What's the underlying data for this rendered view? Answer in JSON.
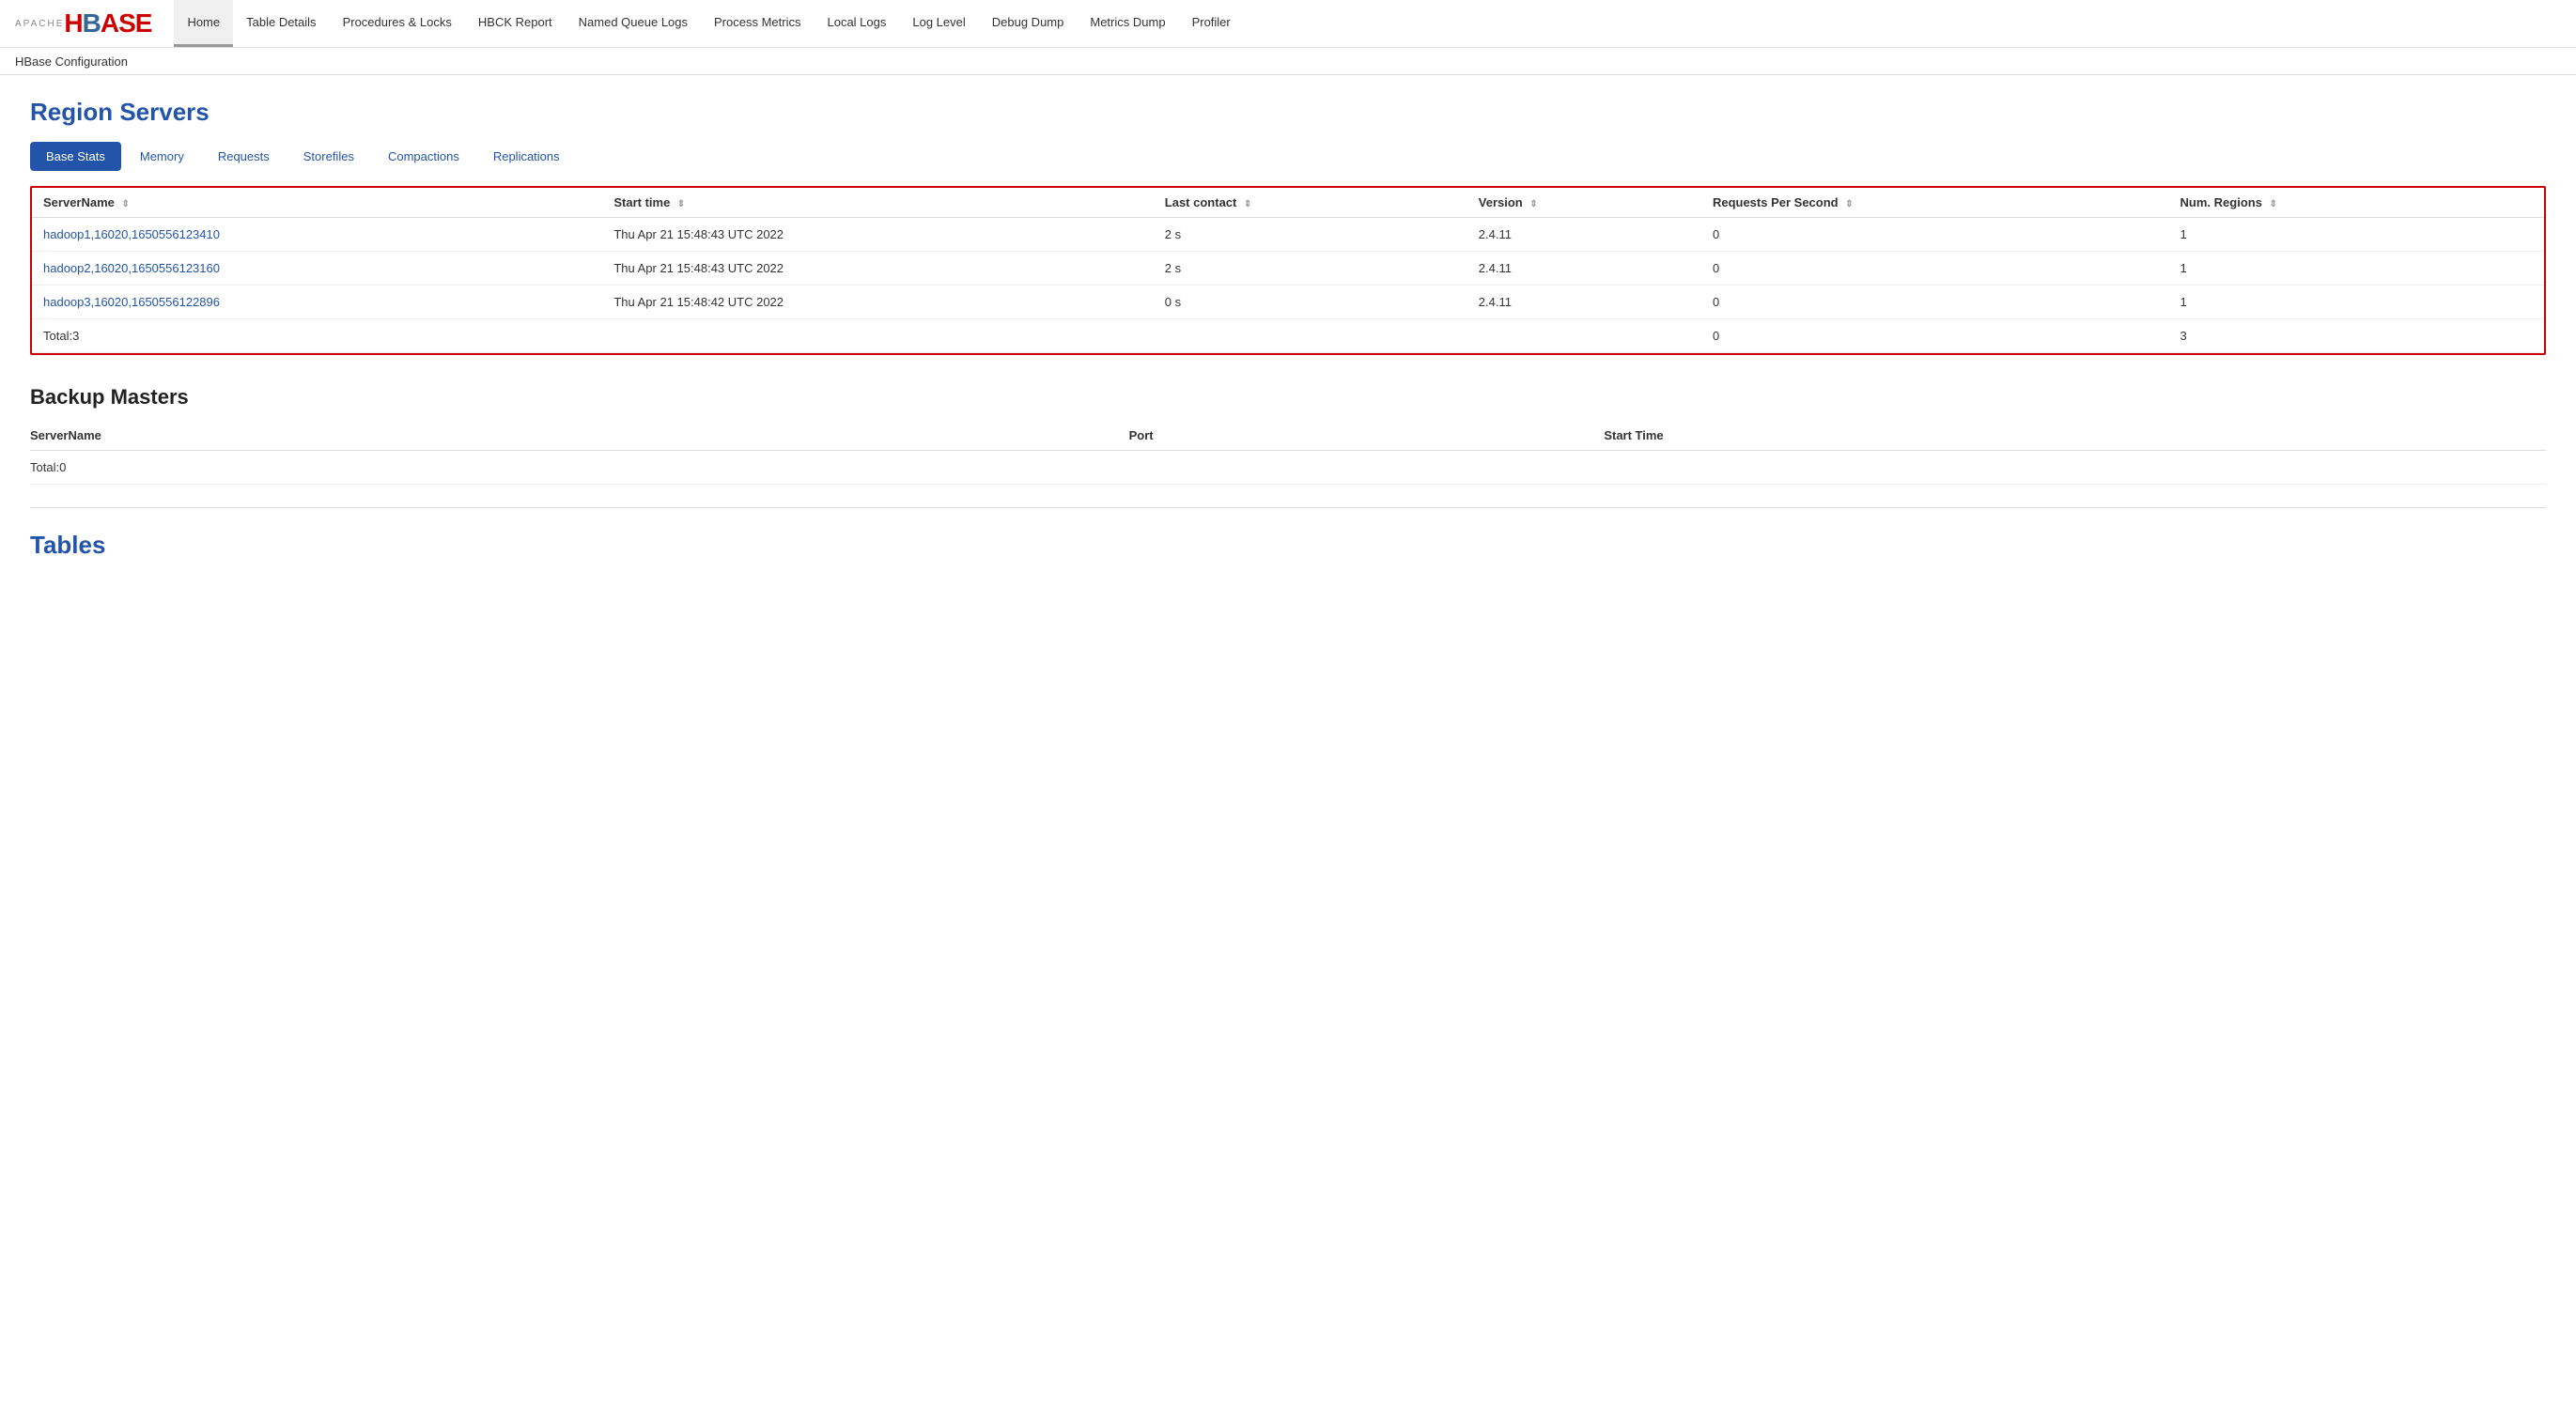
{
  "logo": {
    "apache": "APACHE",
    "hbase": "HBASE"
  },
  "nav": {
    "items": [
      {
        "label": "Home",
        "active": true
      },
      {
        "label": "Table Details",
        "active": false
      },
      {
        "label": "Procedures & Locks",
        "active": false
      },
      {
        "label": "HBCK Report",
        "active": false
      },
      {
        "label": "Named Queue Logs",
        "active": false
      },
      {
        "label": "Process Metrics",
        "active": false
      },
      {
        "label": "Local Logs",
        "active": false
      },
      {
        "label": "Log Level",
        "active": false
      },
      {
        "label": "Debug Dump",
        "active": false
      },
      {
        "label": "Metrics Dump",
        "active": false
      },
      {
        "label": "Profiler",
        "active": false
      }
    ],
    "sub_item": "HBase Configuration"
  },
  "region_servers": {
    "title": "Region Servers",
    "tabs": [
      {
        "label": "Base Stats",
        "active": true
      },
      {
        "label": "Memory",
        "active": false
      },
      {
        "label": "Requests",
        "active": false
      },
      {
        "label": "Storefiles",
        "active": false
      },
      {
        "label": "Compactions",
        "active": false
      },
      {
        "label": "Replications",
        "active": false
      }
    ],
    "columns": [
      "ServerName",
      "Start time",
      "Last contact",
      "Version",
      "Requests Per Second",
      "Num. Regions"
    ],
    "rows": [
      {
        "server_name": "hadoop1,16020,1650556123410",
        "start_time": "Thu Apr 21 15:48:43 UTC 2022",
        "last_contact": "2 s",
        "version": "2.4.11",
        "requests_per_second": "0",
        "num_regions": "1"
      },
      {
        "server_name": "hadoop2,16020,1650556123160",
        "start_time": "Thu Apr 21 15:48:43 UTC 2022",
        "last_contact": "2 s",
        "version": "2.4.11",
        "requests_per_second": "0",
        "num_regions": "1"
      },
      {
        "server_name": "hadoop3,16020,1650556122896",
        "start_time": "Thu Apr 21 15:48:42 UTC 2022",
        "last_contact": "0 s",
        "version": "2.4.11",
        "requests_per_second": "0",
        "num_regions": "1"
      }
    ],
    "total": {
      "label": "Total:3",
      "requests_per_second": "0",
      "num_regions": "3"
    }
  },
  "backup_masters": {
    "title": "Backup Masters",
    "columns": [
      "ServerName",
      "Port",
      "Start Time"
    ],
    "total": {
      "label": "Total:0"
    }
  },
  "tables": {
    "title": "Tables"
  }
}
